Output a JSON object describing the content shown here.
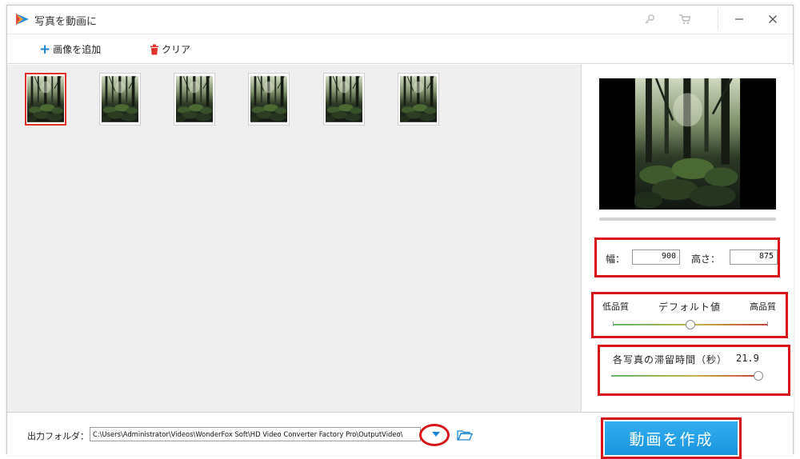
{
  "window": {
    "title": "写真を動画に",
    "logo_icon": "app-logo-icon",
    "title_buttons": [
      "key-icon",
      "cart-icon",
      "minimize-icon",
      "close-icon"
    ]
  },
  "toolbar": {
    "add_label": "画像を追加",
    "clear_label": "クリア",
    "add_icon": "plus-icon",
    "clear_icon": "trash-icon",
    "accent_color": "#1c87d8",
    "delete_color": "#e0302a"
  },
  "thumbnails": {
    "count": 6,
    "selected_index": 0,
    "selection_color": "#e0302a"
  },
  "settings": {
    "width_label": "幅：",
    "width_value": "900",
    "height_label": "高さ：",
    "height_value": "875",
    "quality": {
      "low_label": "低品質",
      "default_label": "デフォルト値",
      "high_label": "高品質",
      "level": 0.5
    },
    "duration": {
      "label": "各写真の滞留時間（秒）",
      "value": "21.9",
      "level": 1.0
    }
  },
  "output": {
    "label": "出力フォルダ：",
    "path": "C:\\Users\\Administrator\\Videos\\WonderFox Soft\\HD Video Converter Factory Pro\\OutputVideo\\",
    "folder_icon": "folder-open-icon"
  },
  "create_button": {
    "label": "動画を作成",
    "color": "#1c9be6"
  },
  "highlight_color": "#d7141a"
}
